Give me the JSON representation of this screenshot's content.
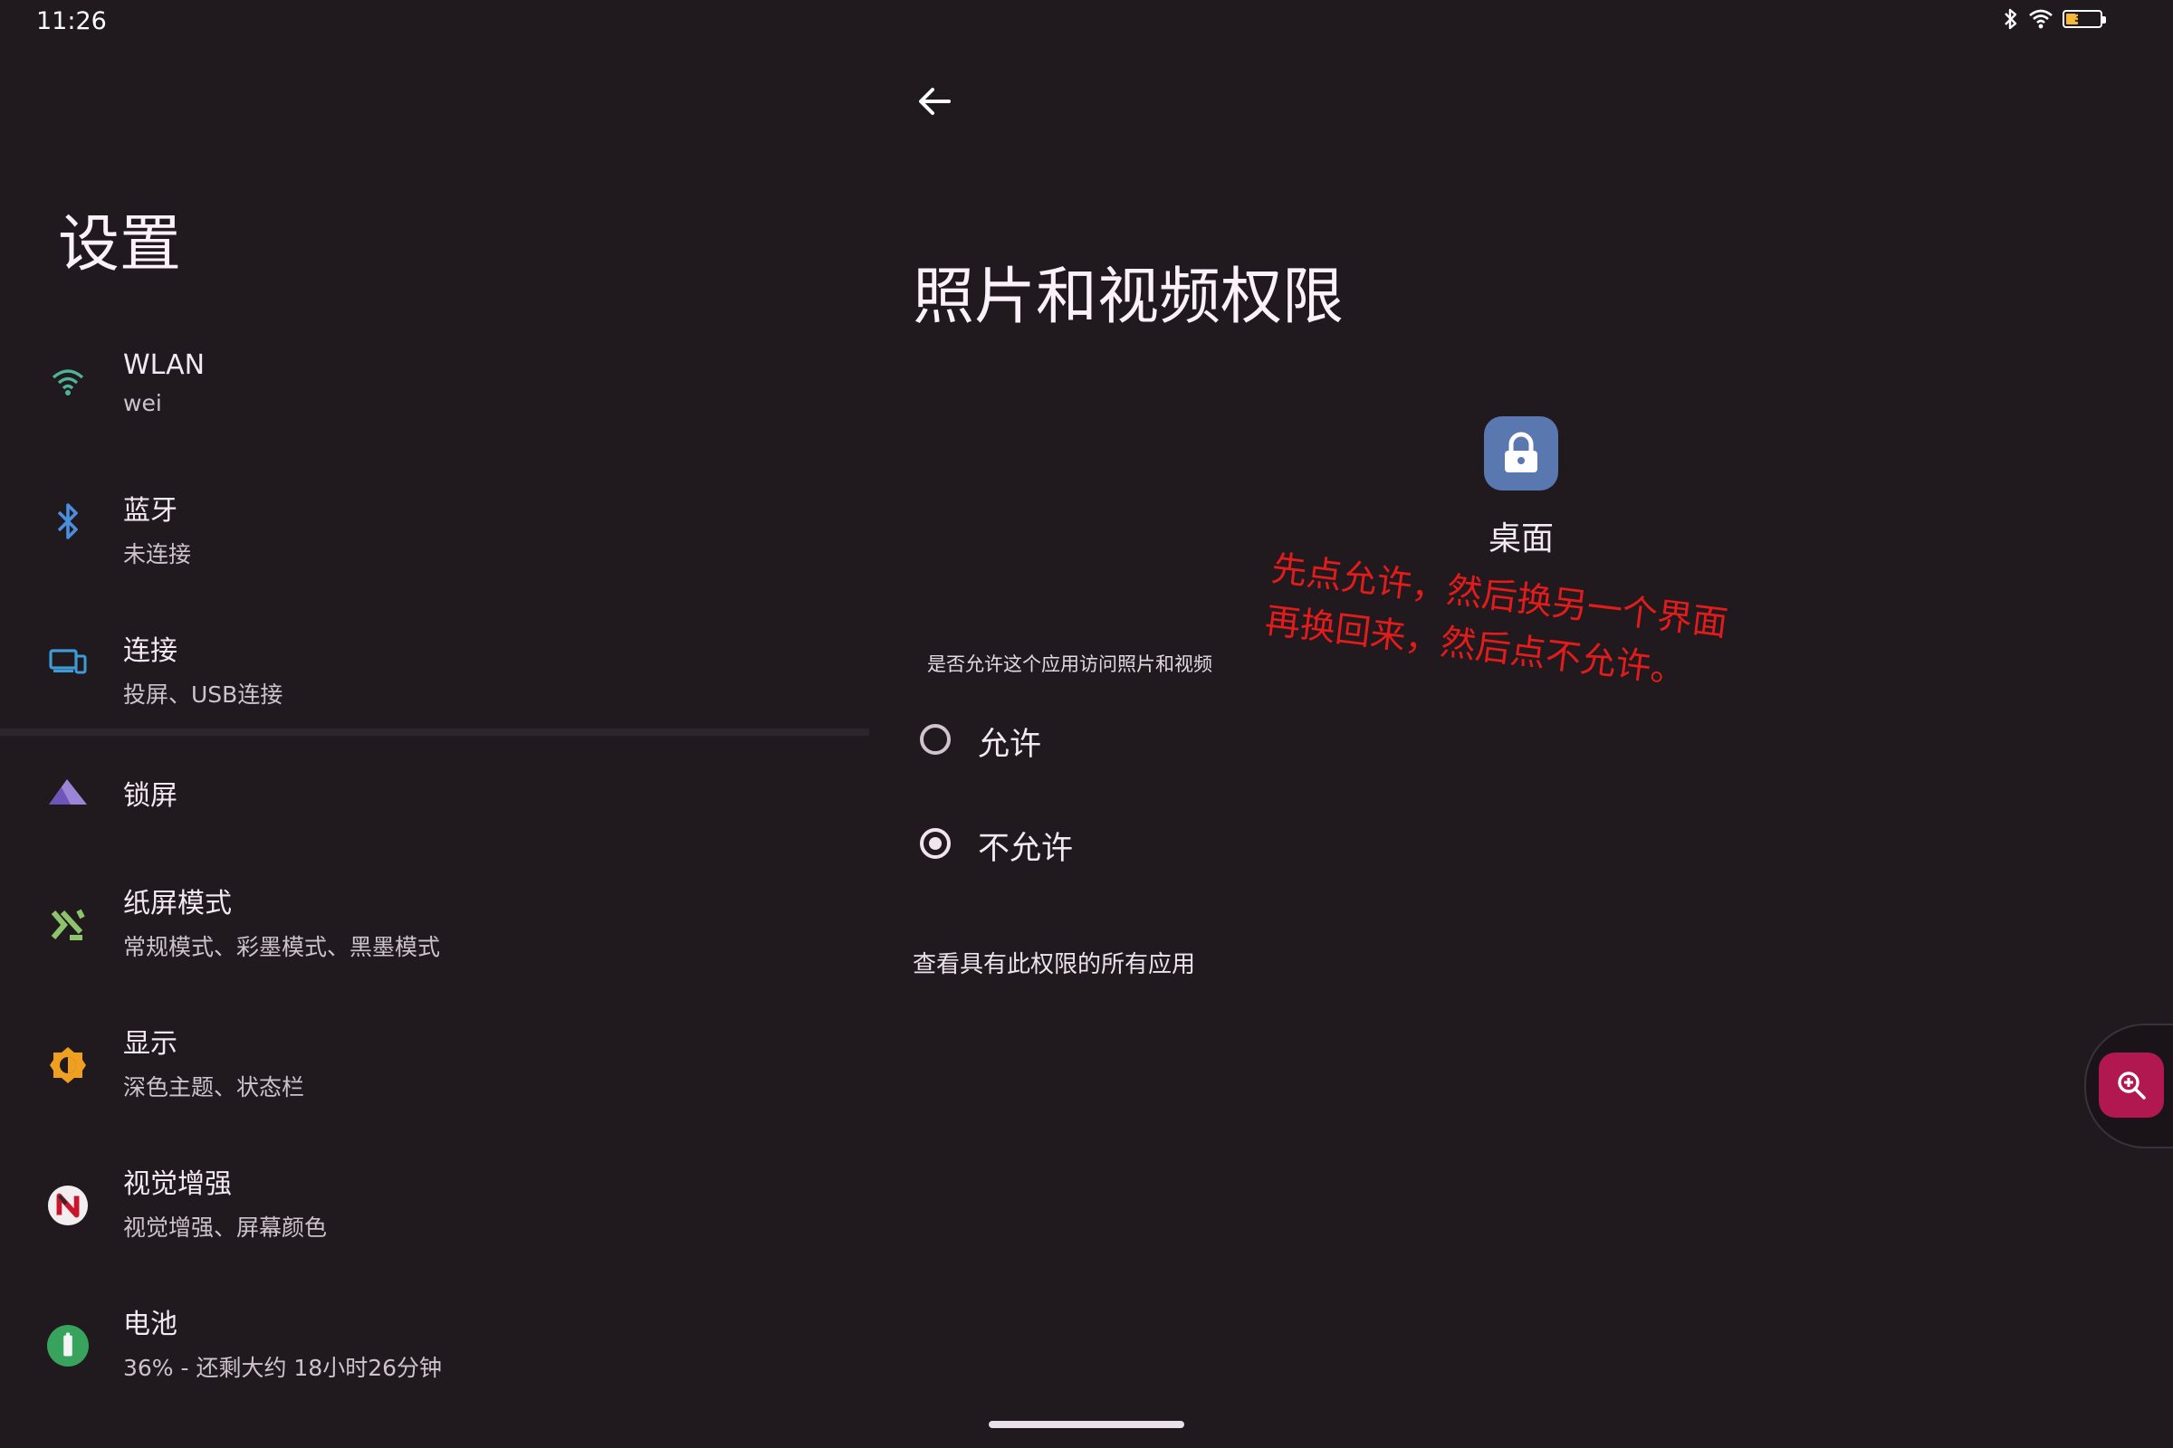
{
  "status_bar": {
    "time": "11:26",
    "battery_level": "36",
    "battery_percent": 0.36
  },
  "settings": {
    "title": "设置",
    "items": [
      {
        "label": "WLAN",
        "sub": "wei",
        "icon": "wifi-icon"
      },
      {
        "label": "蓝牙",
        "sub": "未连接",
        "icon": "bluetooth-icon"
      },
      {
        "label": "连接",
        "sub": "投屏、USB连接",
        "icon": "devices-icon"
      },
      {
        "label": "锁屏",
        "sub": "",
        "icon": "mountain-icon"
      },
      {
        "label": "纸屏模式",
        "sub": "常规模式、彩墨模式、黑墨模式",
        "icon": "paper-mode-icon"
      },
      {
        "label": "显示",
        "sub": "深色主题、状态栏",
        "icon": "brightness-icon"
      },
      {
        "label": "视觉增强",
        "sub": "视觉增强、屏幕颜色",
        "icon": "visual-enhance-icon"
      },
      {
        "label": "电池",
        "sub": "36% - 还剩大约 18小时26分钟",
        "icon": "battery-icon"
      }
    ]
  },
  "permission": {
    "title": "照片和视频权限",
    "app_name": "桌面",
    "question": "是否允许这个应用访问照片和视频",
    "options": [
      {
        "label": "允许",
        "selected": false
      },
      {
        "label": "不允许",
        "selected": true
      }
    ],
    "view_all": "查看具有此权限的所有应用",
    "annotation": "先点允许，然后换另一个界面再换回来，然后点不允许。"
  },
  "colors": {
    "background": "#201a1f",
    "annotation": "#e21b1b",
    "zoom_button": "#b0184f",
    "app_icon": "#5a78b0"
  }
}
